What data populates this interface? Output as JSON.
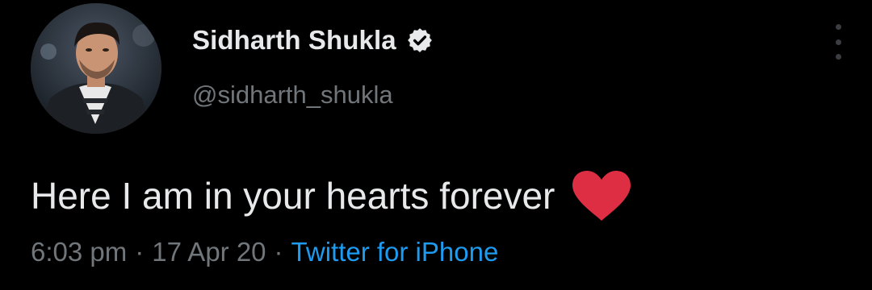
{
  "tweet": {
    "author": {
      "display_name": "Sidharth Shukla",
      "handle": "@sidharth_shukla",
      "verified": true
    },
    "text": "Here I am in your hearts forever",
    "emoji": "red-heart",
    "meta": {
      "time": "6:03 pm",
      "date": "17 Apr 20",
      "separator": "·",
      "source": "Twitter for iPhone"
    },
    "icons": {
      "verified": "verified-badge-icon",
      "more": "more-vertical-icon",
      "heart": "heart-emoji"
    },
    "colors": {
      "background": "#000000",
      "text": "#e7e9ea",
      "secondary": "#71767b",
      "link": "#1d9bf0",
      "heart": "#dd2e44"
    }
  }
}
